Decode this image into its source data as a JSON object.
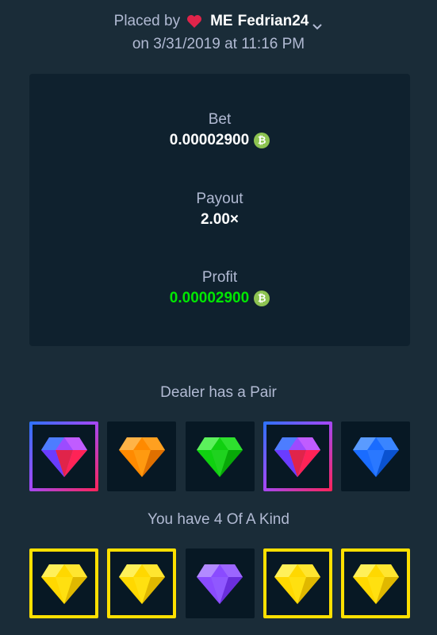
{
  "header": {
    "placed_by": "Placed by",
    "badge": "ME",
    "username": "Fedrian24",
    "placed_on": "on 3/31/2019 at 11:16 PM"
  },
  "bet": {
    "label": "Bet",
    "value": "0.00002900",
    "currency_icon": "bitcoin-cash-icon"
  },
  "payout": {
    "label": "Payout",
    "value": "2.00×"
  },
  "profit": {
    "label": "Profit",
    "value": "0.00002900",
    "currency_icon": "bitcoin-cash-icon"
  },
  "dealer": {
    "title": "Dealer has a Pair",
    "gems": [
      {
        "color": "purple-red",
        "highlighted": true
      },
      {
        "color": "orange",
        "highlighted": false
      },
      {
        "color": "green",
        "highlighted": false
      },
      {
        "color": "purple-red",
        "highlighted": true
      },
      {
        "color": "blue",
        "highlighted": false
      }
    ]
  },
  "player": {
    "title": "You have 4 Of A Kind",
    "gems": [
      {
        "color": "yellow",
        "highlighted": true
      },
      {
        "color": "yellow",
        "highlighted": true
      },
      {
        "color": "purple",
        "highlighted": false
      },
      {
        "color": "yellow",
        "highlighted": true
      },
      {
        "color": "yellow",
        "highlighted": true
      }
    ]
  },
  "colors": {
    "background": "#1a2c38",
    "card": "#0f212e",
    "profit_green": "#00e701",
    "coin": "#8dc351",
    "heart": "#e0244a",
    "highlight_yellow": "#ffe000"
  }
}
